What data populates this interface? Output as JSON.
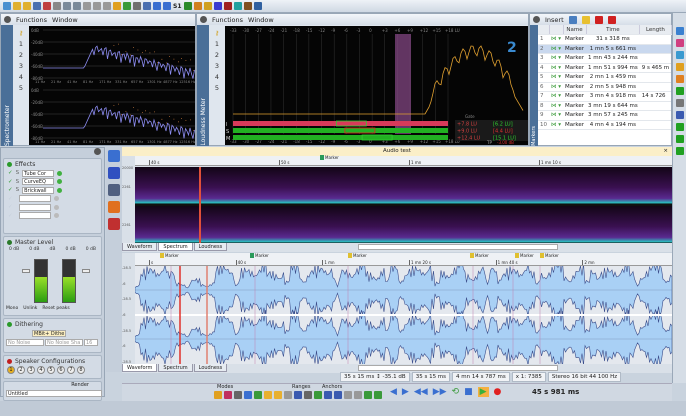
{
  "toolbar": {
    "icons": [
      "new-icon",
      "open-icon",
      "folder-icon",
      "save-icon",
      "save-all-icon",
      "print-icon",
      "undo-icon",
      "redo-icon",
      "cut-icon",
      "copy-icon",
      "paste-icon",
      "marker-tool-icon",
      "color-icon",
      "zoom-icon",
      "pencil-icon",
      "play-icon",
      "stop-icon",
      "s1-label"
    ],
    "s1": "S1"
  },
  "spectrometer": {
    "menu": [
      "Functions",
      "Window"
    ],
    "side_label": "Spectrometer",
    "numbers": [
      "1",
      "2",
      "3",
      "4",
      "5"
    ],
    "y_ticks": [
      "0dB",
      "-20dB",
      "-40dB",
      "-60dB",
      "-80dB"
    ],
    "x_ticks": [
      "11 Hz",
      "21 Hz",
      "41 Hz",
      "81 Hz",
      "171 Hz",
      "331 Hz",
      "657 Hz",
      "1301 Hz",
      "4877 Hz",
      "12516 Hz"
    ]
  },
  "loudness": {
    "menu": [
      "Functions",
      "Window"
    ],
    "side_label": "Loudness Meter",
    "numbers": [
      "1",
      "2",
      "3",
      "4",
      "5"
    ],
    "scale": [
      "-33",
      "-30",
      "-27",
      "-24",
      "-21",
      "-18",
      "-15",
      "-12",
      "-9",
      "-6",
      "-3",
      "0",
      "+3",
      "+6",
      "+9",
      "+12",
      "+15",
      "+18 LU"
    ],
    "rows": [
      {
        "label": "I",
        "value": "+7.8 LU",
        "range": "[6.2 LU]",
        "fill": 0.62
      },
      {
        "label": "S",
        "value": "+9.0 LU",
        "range": "[4.4 LU]",
        "fill": 0.66
      },
      {
        "label": "M",
        "value": "+12.4 LU",
        "range": "[15.1 LU]",
        "fill": 0.74
      }
    ],
    "gate_label": "Gate",
    "tp_label": "TP",
    "tp_value": "-3.00 dB",
    "logo": "2"
  },
  "markers": {
    "insert_label": "Insert",
    "side_label": "Markers",
    "columns": [
      "",
      "Name",
      "Time",
      "Length"
    ],
    "rows": [
      {
        "n": "1",
        "name": "Marker",
        "time": "31 s 318 ms",
        "length": ""
      },
      {
        "n": "2",
        "name": "Marker",
        "time": "1 mn 5 s 661 ms",
        "length": ""
      },
      {
        "n": "3",
        "name": "Marker",
        "time": "1 mn 43 s 244 ms",
        "length": ""
      },
      {
        "n": "4",
        "name": "Marker",
        "time": "1 mn 51 s 994 ms",
        "length": "9 s 465 m"
      },
      {
        "n": "5",
        "name": "Marker",
        "time": "2 mn 1 s 459 ms",
        "length": ""
      },
      {
        "n": "6",
        "name": "Marker",
        "time": "2 mn 5 s 948 ms",
        "length": ""
      },
      {
        "n": "7",
        "name": "Marker",
        "time": "3 mn 4 s 918 ms",
        "length": "14 s 726"
      },
      {
        "n": "8",
        "name": "Marker",
        "time": "3 mn 19 s 644 ms",
        "length": ""
      },
      {
        "n": "9",
        "name": "Marker",
        "time": "3 mn 57 s 245 ms",
        "length": ""
      },
      {
        "n": "10",
        "name": "Marker",
        "time": "4 mn 4 s 194 ms",
        "length": ""
      }
    ]
  },
  "effects": {
    "title": "Effects",
    "slots": [
      {
        "name": "Tube Cor",
        "on": true
      },
      {
        "name": "CurveEQ",
        "on": true
      },
      {
        "name": "Brickwall",
        "on": true
      },
      {
        "name": "",
        "on": false
      },
      {
        "name": "",
        "on": false
      },
      {
        "name": "",
        "on": false
      }
    ]
  },
  "master": {
    "title": "Master Level",
    "labels": [
      "0 dB",
      "0 dB",
      "dB",
      "0 dB",
      "0 dB"
    ],
    "mono": "Mono",
    "unlink": "Unlink",
    "reset": "Reset peaks",
    "level": 0.6
  },
  "dithering": {
    "title": "Dithering",
    "plugin": "MBit+ Dithe",
    "noise": "No Noise",
    "shaping": "No Noise Sha",
    "bits": "16 b"
  },
  "speakers": {
    "title": "Speaker Configurations",
    "numbers": [
      "1",
      "2",
      "3",
      "4",
      "5",
      "6",
      "7",
      "8"
    ]
  },
  "render": {
    "label": "Render",
    "project": "Untitled"
  },
  "document": {
    "title": "Audio test"
  },
  "spectrum_view": {
    "ruler": [
      "40 s",
      "50 s",
      "1 mn",
      "1 mn 10 s"
    ],
    "marker": "Marker",
    "y_ticks": [
      "20000",
      "2261",
      "",
      "2261"
    ],
    "tabs": [
      "Waveform",
      "Spectrum",
      "Loudness"
    ]
  },
  "waveform_view": {
    "ruler": [
      "s",
      "40 s",
      "1 mn",
      "1 mn 20 s",
      "1 mn 40 s",
      "2 mn"
    ],
    "markers": [
      "Marker",
      "Marker",
      "Marker",
      "Marker",
      "Marker",
      "Marker"
    ],
    "y_ticks": [
      "-28.5",
      "-6",
      "-28.5",
      "-6",
      "-28.5",
      "-6",
      "-28.5"
    ],
    "tabs": [
      "Waveform",
      "Spectrum",
      "Loudness"
    ]
  },
  "status": {
    "cursor": "35 s 15 ms",
    "level": "-35.1 dB",
    "position": "35 s 15 ms",
    "length": "4 mn 14 s 787 ms",
    "zoom": "x 1: 7385",
    "format": "Stereo 16 bit 44 100 Hz"
  },
  "transport": {
    "modes": "Modes",
    "ranges": "Ranges",
    "anchors": "Anchors",
    "time": "45 s 981 ms"
  },
  "colors": {
    "waveform": "#a9d0f5",
    "waveform_edge": "#3a4c8a",
    "cursor": "#e0302a",
    "spectrum": "#6b2a8a",
    "meter_green": "#22b022",
    "meter_red": "#d83a5a",
    "loudness_curve": "#e0a030"
  }
}
